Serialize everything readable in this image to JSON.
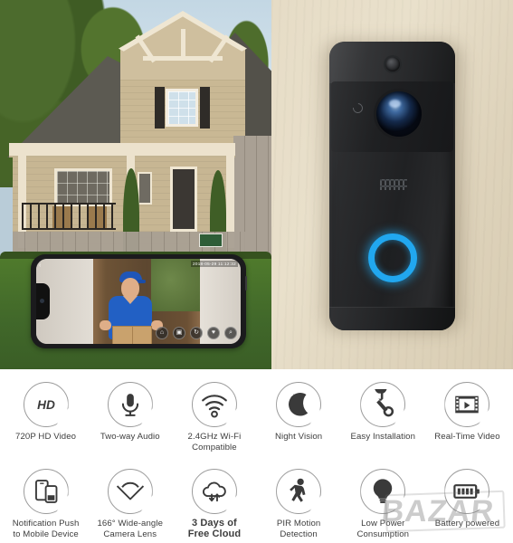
{
  "product": {
    "name": "Smart Video Doorbell",
    "led_ring_color": "#21a7ef",
    "body_color": "#202123",
    "wall_color": "#e6dcc6"
  },
  "app_preview": {
    "timestamp": "2018-05-29  11:12:32",
    "back_icon": "chevron-left-icon",
    "controls": [
      {
        "name": "unlock-button",
        "glyph": "⌂"
      },
      {
        "name": "snapshot-button",
        "glyph": "▣"
      },
      {
        "name": "record-button",
        "glyph": "↻"
      },
      {
        "name": "microphone-button",
        "glyph": "♥"
      },
      {
        "name": "hangup-button",
        "glyph": "⌕"
      }
    ]
  },
  "features": {
    "rows": [
      [
        {
          "icon": "hd-icon",
          "label": "720P HD Video"
        },
        {
          "icon": "microphone-icon",
          "label": "Two-way Audio"
        },
        {
          "icon": "wifi-icon",
          "label": "2.4GHz Wi-Fi\nCompatible"
        },
        {
          "icon": "moon-star-icon",
          "label": "Night Vision"
        },
        {
          "icon": "wrench-icon",
          "label": "Easy Installation"
        },
        {
          "icon": "film-play-icon",
          "label": "Real-Time Video"
        }
      ],
      [
        {
          "icon": "mobile-devices-icon",
          "label": "Notification Push\nto Mobile Device"
        },
        {
          "icon": "wide-angle-icon",
          "label": "166° Wide-angle\nCamera Lens"
        },
        {
          "icon": "cloud-sync-icon",
          "label": "3 Days of\nFree Cloud"
        },
        {
          "icon": "walking-person-icon",
          "label": "PIR Motion\nDetection"
        },
        {
          "icon": "lightbulb-icon",
          "label": "Low Power\nConsumption"
        },
        {
          "icon": "battery-icon",
          "label": "Battery powered"
        }
      ]
    ]
  },
  "watermark": {
    "text": "BAZAR"
  }
}
